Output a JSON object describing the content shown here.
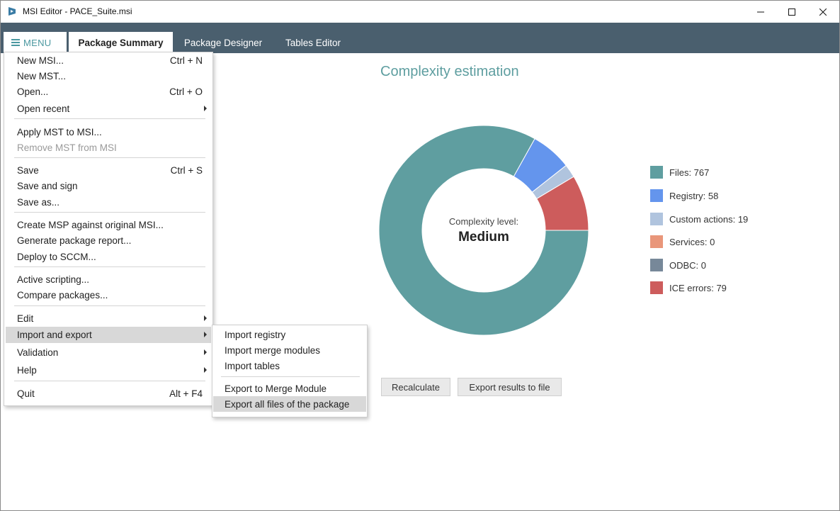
{
  "window": {
    "title": "MSI Editor - PACE_Suite.msi"
  },
  "tabs": {
    "menu_label": "MENU",
    "items": [
      {
        "label": "Package Summary",
        "active": true
      },
      {
        "label": "Package Designer",
        "active": false
      },
      {
        "label": "Tables Editor",
        "active": false
      }
    ]
  },
  "menu": {
    "items": [
      {
        "label": "New MSI...",
        "shortcut": "Ctrl + N"
      },
      {
        "label": "New MST...",
        "shortcut": ""
      },
      {
        "label": "Open...",
        "shortcut": "Ctrl + O"
      },
      {
        "label": "Open recent",
        "submenu": true
      },
      {
        "label": "Apply MST to MSI..."
      },
      {
        "label": "Remove MST from MSI",
        "disabled": true
      },
      {
        "label": "Save",
        "shortcut": "Ctrl + S"
      },
      {
        "label": "Save and sign"
      },
      {
        "label": "Save as..."
      },
      {
        "label": "Create MSP against original MSI..."
      },
      {
        "label": "Generate package report..."
      },
      {
        "label": "Deploy to SCCM..."
      },
      {
        "label": "Active scripting..."
      },
      {
        "label": "Compare packages..."
      },
      {
        "label": "Edit",
        "submenu": true
      },
      {
        "label": "Import and export",
        "submenu": true,
        "highlighted": true
      },
      {
        "label": "Validation",
        "submenu": true
      },
      {
        "label": "Help",
        "submenu": true
      },
      {
        "label": "Quit",
        "shortcut": "Alt + F4"
      }
    ]
  },
  "submenu": {
    "items": [
      {
        "label": "Import registry"
      },
      {
        "label": "Import merge modules"
      },
      {
        "label": "Import tables"
      },
      {
        "label": "Export to Merge Module"
      },
      {
        "label": "Export all files of the package",
        "highlighted": true
      }
    ]
  },
  "complexity": {
    "title": "Complexity estimation",
    "center_label": "Complexity level:",
    "center_value": "Medium",
    "legend": [
      {
        "label": "Files: 767",
        "color": "#5f9ea0"
      },
      {
        "label": "Registry: 58",
        "color": "#6495ed"
      },
      {
        "label": "Custom actions: 19",
        "color": "#b0c4de"
      },
      {
        "label": "Services: 0",
        "color": "#e9967a"
      },
      {
        "label": "ODBC: 0",
        "color": "#778899"
      },
      {
        "label": "ICE errors: 79",
        "color": "#cd5c5c"
      }
    ],
    "buttons": {
      "recalculate": "Recalculate",
      "export": "Export results to file"
    }
  },
  "chart_data": {
    "type": "pie",
    "categories": [
      "Files",
      "Registry",
      "Custom actions",
      "Services",
      "ODBC",
      "ICE errors"
    ],
    "values": [
      767,
      58,
      19,
      0,
      0,
      79
    ],
    "colors": [
      "#5f9ea0",
      "#6495ed",
      "#b0c4de",
      "#e9967a",
      "#778899",
      "#cd5c5c"
    ],
    "title": "Complexity estimation",
    "donut": true,
    "legend_position": "right"
  }
}
